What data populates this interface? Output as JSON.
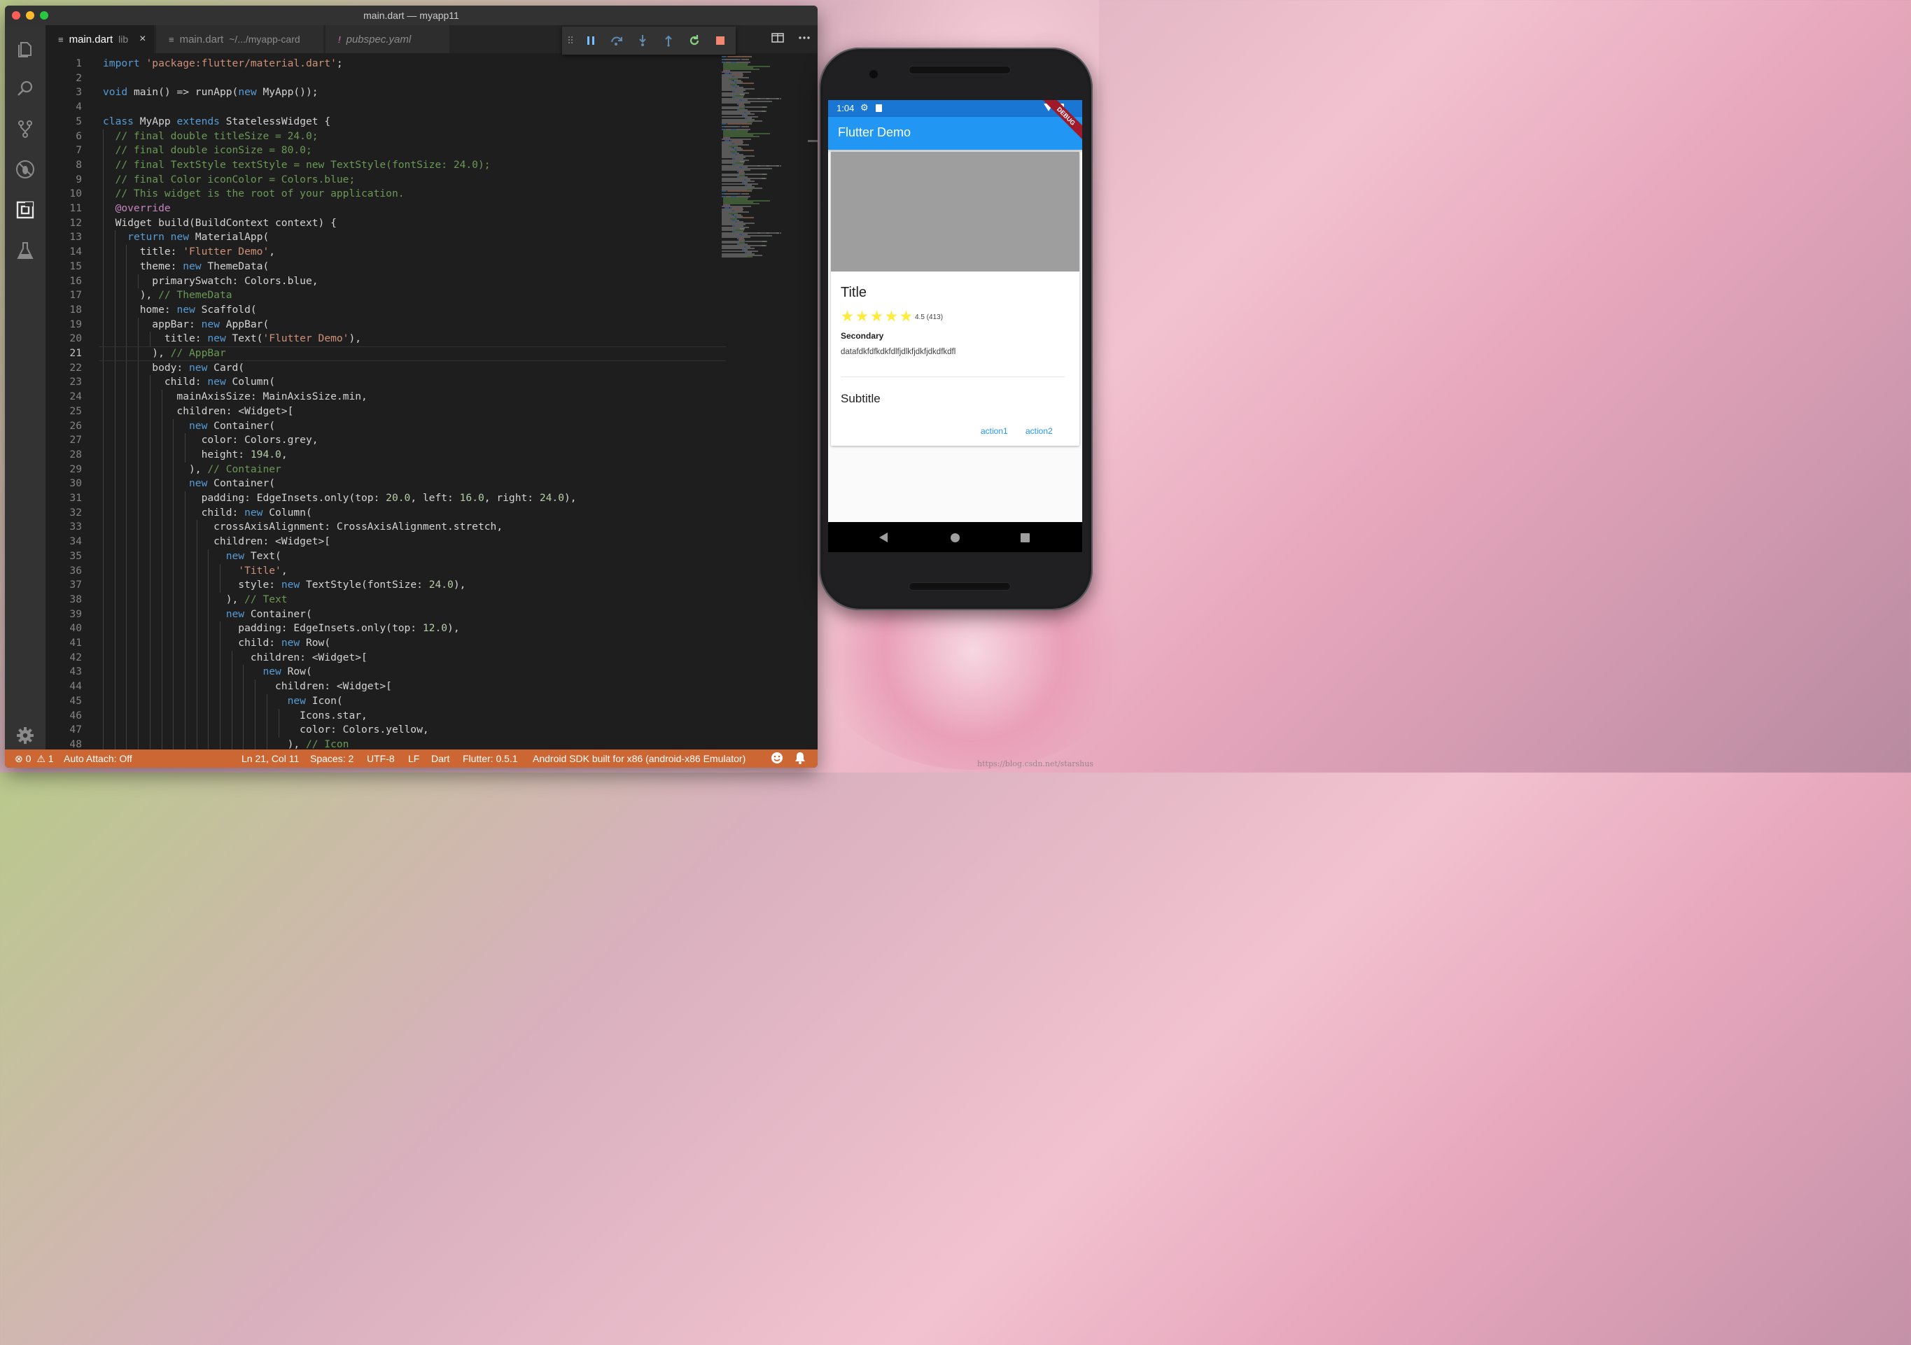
{
  "window": {
    "title": "main.dart — myapp11"
  },
  "tabs": [
    {
      "icon": "≡",
      "label": "main.dart",
      "sub": "lib",
      "close": "×"
    },
    {
      "icon": "≡",
      "label": "main.dart",
      "sub": "~/.../myapp-card"
    },
    {
      "icon": "!",
      "label": "pubspec.yaml"
    }
  ],
  "debug_toolbar": [
    "pause",
    "step-over",
    "step-into",
    "step-out",
    "restart",
    "stop"
  ],
  "code": {
    "current_line": 21,
    "lines": [
      [
        [
          "kw",
          "import"
        ],
        [
          "p",
          " "
        ],
        [
          "str",
          "'package:flutter/material.dart'"
        ],
        [
          "p",
          ";"
        ]
      ],
      [],
      [
        [
          "kw",
          "void"
        ],
        [
          "p",
          " main() => runApp("
        ],
        [
          "kw",
          "new"
        ],
        [
          "p",
          " MyApp());"
        ]
      ],
      [],
      [
        [
          "kw",
          "class"
        ],
        [
          "p",
          " MyApp "
        ],
        [
          "kw",
          "extends"
        ],
        [
          "p",
          " StatelessWidget {"
        ]
      ],
      [
        [
          "p",
          "  "
        ],
        [
          "cmt",
          "// final double titleSize = 24.0;"
        ]
      ],
      [
        [
          "p",
          "  "
        ],
        [
          "cmt",
          "// final double iconSize = 80.0;"
        ]
      ],
      [
        [
          "p",
          "  "
        ],
        [
          "cmt",
          "// final TextStyle textStyle = new TextStyle(fontSize: 24.0);"
        ]
      ],
      [
        [
          "p",
          "  "
        ],
        [
          "cmt",
          "// final Color iconColor = Colors.blue;"
        ]
      ],
      [
        [
          "p",
          "  "
        ],
        [
          "cmt",
          "// This widget is the root of your application."
        ]
      ],
      [
        [
          "p",
          "  "
        ],
        [
          "ann",
          "@override"
        ]
      ],
      [
        [
          "p",
          "  Widget build(BuildContext context) {"
        ]
      ],
      [
        [
          "p",
          "    "
        ],
        [
          "kw",
          "return"
        ],
        [
          "p",
          " "
        ],
        [
          "kw",
          "new"
        ],
        [
          "p",
          " MaterialApp("
        ]
      ],
      [
        [
          "p",
          "      title: "
        ],
        [
          "str",
          "'Flutter Demo'"
        ],
        [
          "p",
          ","
        ]
      ],
      [
        [
          "p",
          "      theme: "
        ],
        [
          "kw",
          "new"
        ],
        [
          "p",
          " ThemeData("
        ]
      ],
      [
        [
          "p",
          "        primarySwatch: Colors.blue,"
        ]
      ],
      [
        [
          "p",
          "      ), "
        ],
        [
          "cmt",
          "// ThemeData"
        ]
      ],
      [
        [
          "p",
          "      home: "
        ],
        [
          "kw",
          "new"
        ],
        [
          "p",
          " Scaffold("
        ]
      ],
      [
        [
          "p",
          "        appBar: "
        ],
        [
          "kw",
          "new"
        ],
        [
          "p",
          " AppBar("
        ]
      ],
      [
        [
          "p",
          "          title: "
        ],
        [
          "kw",
          "new"
        ],
        [
          "p",
          " Text("
        ],
        [
          "str",
          "'Flutter Demo'"
        ],
        [
          "p",
          "),"
        ]
      ],
      [
        [
          "p",
          "        ), "
        ],
        [
          "cmt",
          "// AppBar"
        ]
      ],
      [
        [
          "p",
          "        body: "
        ],
        [
          "kw",
          "new"
        ],
        [
          "p",
          " Card("
        ]
      ],
      [
        [
          "p",
          "          child: "
        ],
        [
          "kw",
          "new"
        ],
        [
          "p",
          " Column("
        ]
      ],
      [
        [
          "p",
          "            mainAxisSize: MainAxisSize.min,"
        ]
      ],
      [
        [
          "p",
          "            children: <Widget>["
        ]
      ],
      [
        [
          "p",
          "              "
        ],
        [
          "kw",
          "new"
        ],
        [
          "p",
          " Container("
        ]
      ],
      [
        [
          "p",
          "                color: Colors.grey,"
        ]
      ],
      [
        [
          "p",
          "                height: "
        ],
        [
          "num",
          "194.0"
        ],
        [
          "p",
          ","
        ]
      ],
      [
        [
          "p",
          "              ), "
        ],
        [
          "cmt",
          "// Container"
        ]
      ],
      [
        [
          "p",
          "              "
        ],
        [
          "kw",
          "new"
        ],
        [
          "p",
          " Container("
        ]
      ],
      [
        [
          "p",
          "                padding: EdgeInsets.only(top: "
        ],
        [
          "num",
          "20.0"
        ],
        [
          "p",
          ", left: "
        ],
        [
          "num",
          "16.0"
        ],
        [
          "p",
          ", right: "
        ],
        [
          "num",
          "24.0"
        ],
        [
          "p",
          "),"
        ]
      ],
      [
        [
          "p",
          "                child: "
        ],
        [
          "kw",
          "new"
        ],
        [
          "p",
          " Column("
        ]
      ],
      [
        [
          "p",
          "                  crossAxisAlignment: CrossAxisAlignment.stretch,"
        ]
      ],
      [
        [
          "p",
          "                  children: <Widget>["
        ]
      ],
      [
        [
          "p",
          "                    "
        ],
        [
          "kw",
          "new"
        ],
        [
          "p",
          " Text("
        ]
      ],
      [
        [
          "p",
          "                      "
        ],
        [
          "str",
          "'Title'"
        ],
        [
          "p",
          ","
        ]
      ],
      [
        [
          "p",
          "                      style: "
        ],
        [
          "kw",
          "new"
        ],
        [
          "p",
          " TextStyle(fontSize: "
        ],
        [
          "num",
          "24.0"
        ],
        [
          "p",
          "),"
        ]
      ],
      [
        [
          "p",
          "                    ), "
        ],
        [
          "cmt",
          "// Text"
        ]
      ],
      [
        [
          "p",
          "                    "
        ],
        [
          "kw",
          "new"
        ],
        [
          "p",
          " Container("
        ]
      ],
      [
        [
          "p",
          "                      padding: EdgeInsets.only(top: "
        ],
        [
          "num",
          "12.0"
        ],
        [
          "p",
          "),"
        ]
      ],
      [
        [
          "p",
          "                      child: "
        ],
        [
          "kw",
          "new"
        ],
        [
          "p",
          " Row("
        ]
      ],
      [
        [
          "p",
          "                        children: <Widget>["
        ]
      ],
      [
        [
          "p",
          "                          "
        ],
        [
          "kw",
          "new"
        ],
        [
          "p",
          " Row("
        ]
      ],
      [
        [
          "p",
          "                            children: <Widget>["
        ]
      ],
      [
        [
          "p",
          "                              "
        ],
        [
          "kw",
          "new"
        ],
        [
          "p",
          " Icon("
        ]
      ],
      [
        [
          "p",
          "                                Icons.star,"
        ]
      ],
      [
        [
          "p",
          "                                color: Colors.yellow,"
        ]
      ],
      [
        [
          "p",
          "                              ), "
        ],
        [
          "cmt",
          "// Icon"
        ]
      ]
    ]
  },
  "statusbar": {
    "errors": "0",
    "warnings": "1",
    "auto_attach": "Auto Attach: Off",
    "position": "Ln 21, Col 11",
    "spaces": "Spaces: 2",
    "encoding": "UTF-8",
    "eol": "LF",
    "language": "Dart",
    "flutter": "Flutter: 0.5.1",
    "device": "Android SDK built for x86 (android-x86 Emulator)"
  },
  "phone": {
    "time": "1:04",
    "appbar_title": "Flutter Demo",
    "debug_banner": "DEBUG",
    "card": {
      "title": "Title",
      "stars": 5,
      "rating": "4.5 (413)",
      "secondary": "Secondary",
      "body": "datafdkfdfkdkfdlfjdlkfjdkfjdkdfkdfl",
      "subtitle": "Subtitle",
      "action1": "action1",
      "action2": "action2"
    }
  },
  "watermark": "https://blog.csdn.net/starshus"
}
